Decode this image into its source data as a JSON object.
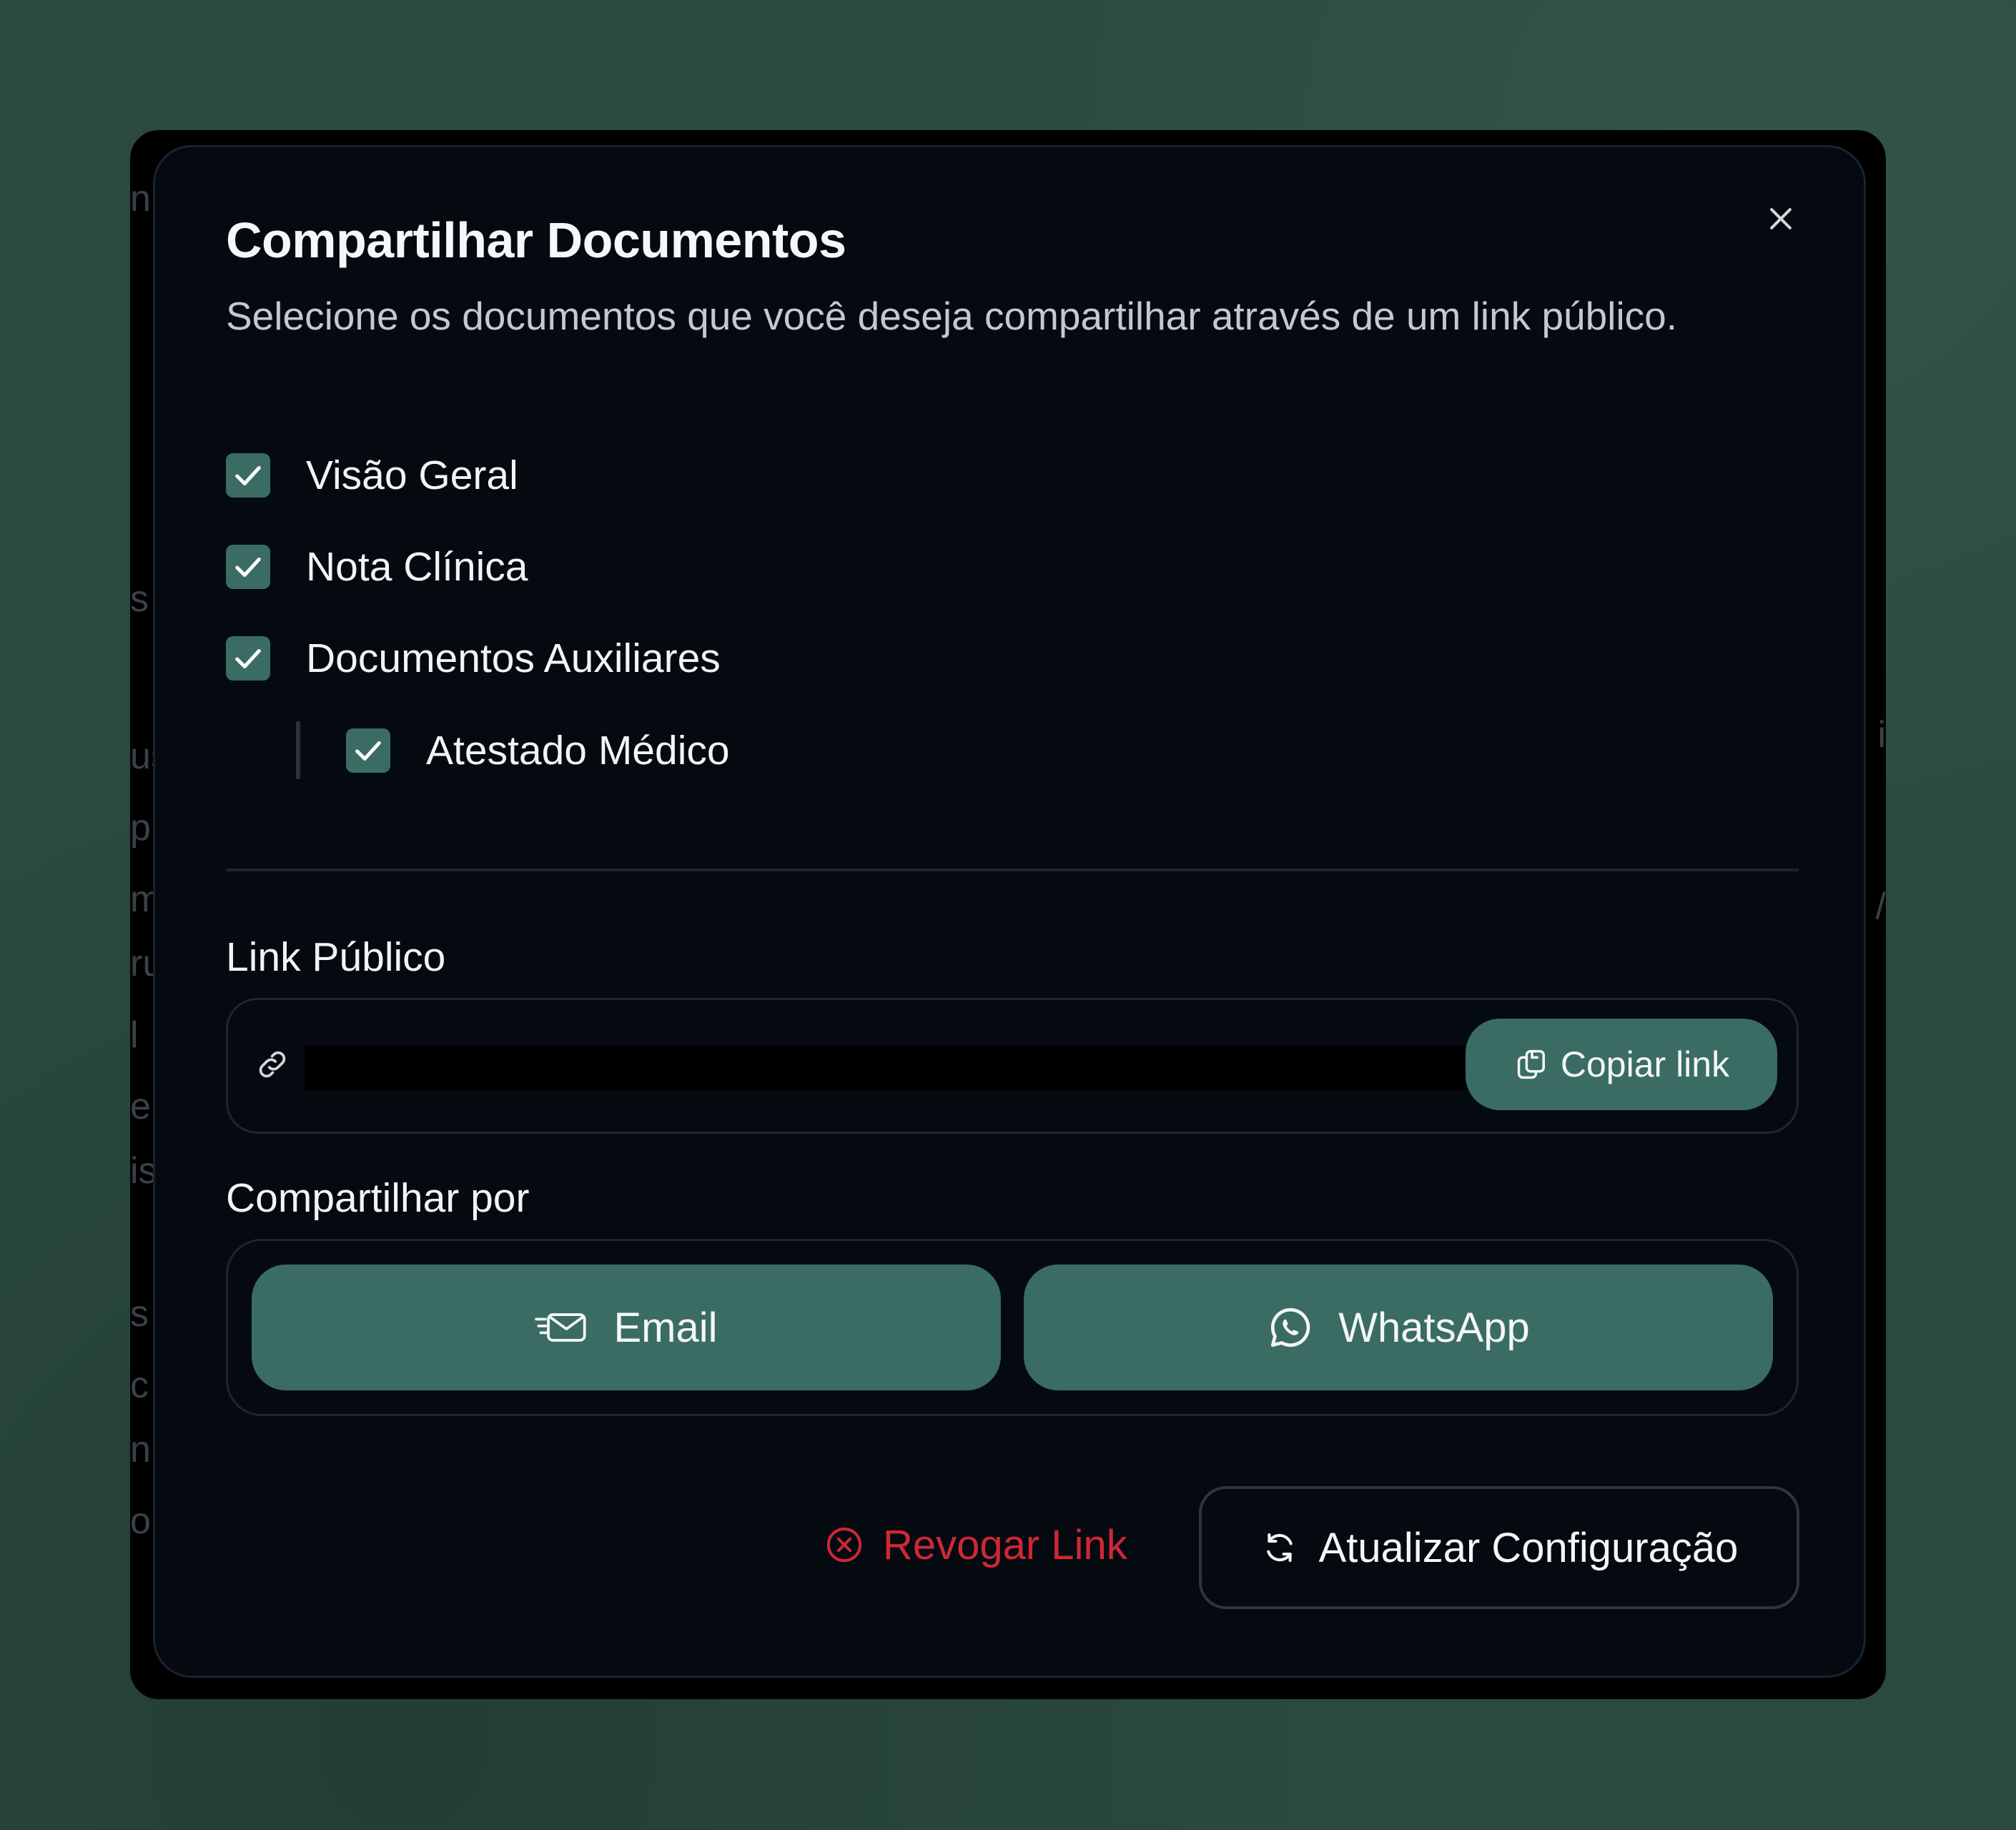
{
  "dialog": {
    "title": "Compartilhar Documentos",
    "subtitle": "Selecione os documentos que você deseja compartilhar através de um link público.",
    "close_icon": "close-icon"
  },
  "documents": [
    {
      "label": "Visão Geral",
      "checked": true
    },
    {
      "label": "Nota Clínica",
      "checked": true
    },
    {
      "label": "Documentos Auxiliares",
      "checked": true
    },
    {
      "label": "Atestado Médico",
      "checked": true,
      "nested": true
    }
  ],
  "public_link": {
    "label": "Link Público",
    "value": "",
    "copy_label": "Copiar link",
    "link_icon": "link-icon",
    "copy_icon": "copy-icon"
  },
  "share": {
    "label": "Compartilhar por",
    "email_label": "Email",
    "whatsapp_label": "WhatsApp",
    "email_icon": "email-send-icon",
    "whatsapp_icon": "whatsapp-icon"
  },
  "actions": {
    "revoke_label": "Revogar Link",
    "update_label": "Atualizar Configuração",
    "revoke_icon": "x-circle-icon",
    "update_icon": "refresh-icon"
  },
  "colors": {
    "accent": "#3b6c64",
    "danger": "#cf2734",
    "modal_background": "#050a11",
    "backdrop": "#2b4941"
  }
}
